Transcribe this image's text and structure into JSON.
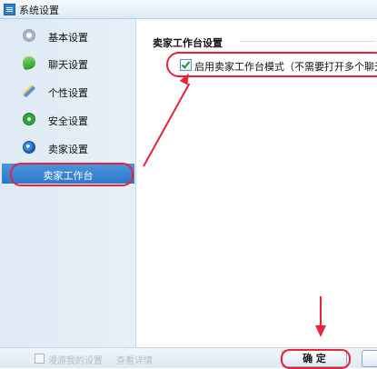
{
  "window": {
    "title": "系统设置"
  },
  "sidebar": {
    "items": [
      {
        "label": "基本设置",
        "icon": "settings-icon"
      },
      {
        "label": "聊天设置",
        "icon": "chat-icon"
      },
      {
        "label": "个性设置",
        "icon": "personalize-icon"
      },
      {
        "label": "安全设置",
        "icon": "security-icon"
      },
      {
        "label": "卖家设置",
        "icon": "seller-icon"
      }
    ],
    "selected_subitem": "卖家工作台"
  },
  "main": {
    "section_title": "卖家工作台设置",
    "option_label": "启用卖家工作台模式（不需要打开多个聊天",
    "option_checked": true
  },
  "footer": {
    "sync_text": "漫游我的设置",
    "details_link": "查看详情",
    "ok_label": "确 定"
  },
  "colors": {
    "accent": "#2f78c8",
    "annotation": "#e8233a"
  }
}
